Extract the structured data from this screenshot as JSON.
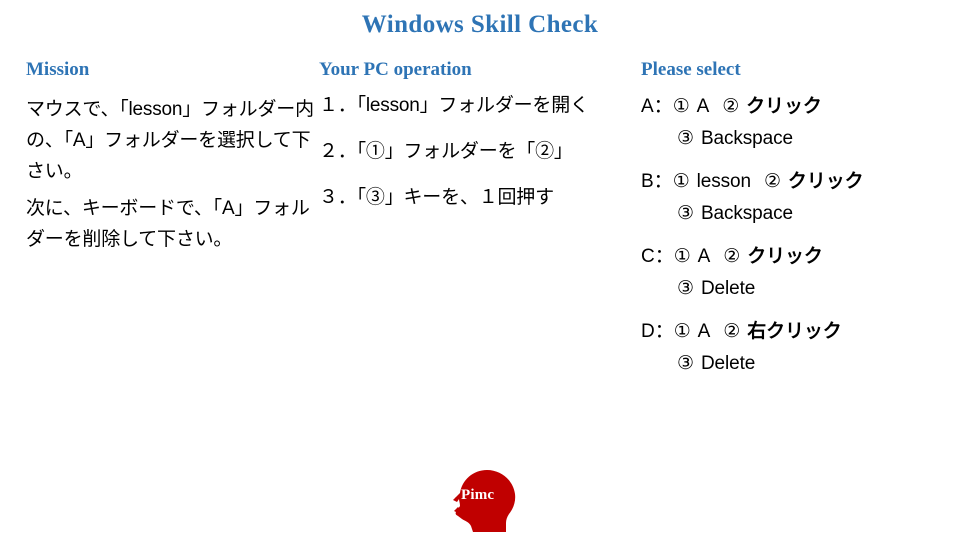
{
  "title": "Windows Skill Check",
  "theme": {
    "accent_blue": "#2E74B5",
    "logo_red": "#C00000",
    "text_black": "#000000",
    "background": "#FFFFFF"
  },
  "mission": {
    "heading": "Mission",
    "paragraphs": [
      "マウスで、「lesson」フォルダー内の、「A」フォルダーを選択して下さい。",
      "次に、キーボードで、「A」フォルダーを削除して下さい。"
    ]
  },
  "operation": {
    "heading": "Your PC operation",
    "steps": [
      "１．「lesson」フォルダーを開く",
      "２．「①」フォルダーを「②」",
      "３．「③」キーを、１回押す"
    ]
  },
  "select": {
    "heading": "Please select",
    "options": [
      {
        "key": "A：",
        "first_marker": "①",
        "first_value": "A",
        "second_marker": "②",
        "second_value": "クリック",
        "third_marker": "③",
        "third_value": "Backspace"
      },
      {
        "key": "B：",
        "first_marker": "①",
        "first_value": "lesson",
        "second_marker": "②",
        "second_value": "クリック",
        "third_marker": "③",
        "third_value": "Backspace"
      },
      {
        "key": "C：",
        "first_marker": "①",
        "first_value": "A",
        "second_marker": "②",
        "second_value": "クリック",
        "third_marker": "③",
        "third_value": "Delete"
      },
      {
        "key": "D：",
        "first_marker": "①",
        "first_value": "A",
        "second_marker": "②",
        "second_value": "右クリック",
        "third_marker": "③",
        "third_value": "Delete"
      }
    ]
  },
  "logo": {
    "word": "Pimc",
    "icon": "head-silhouette-icon",
    "color": "#C00000"
  }
}
